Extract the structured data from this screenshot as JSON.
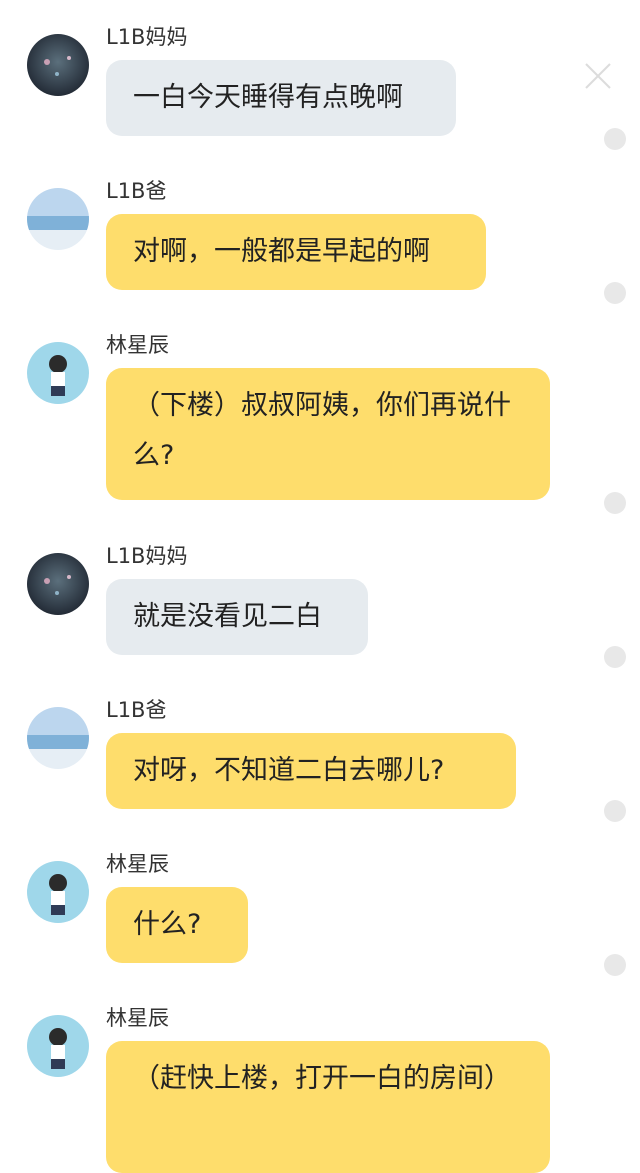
{
  "messages": [
    {
      "sender": "L1B妈妈",
      "text": "一白今天睡得有点晚啊",
      "style": "gray",
      "avatar": "night-sky"
    },
    {
      "sender": "L1B爸",
      "text": "对啊，一般都是早起的啊",
      "style": "yellow",
      "avatar": "sea"
    },
    {
      "sender": "林星辰",
      "text": "（下楼）叔叔阿姨，你们再说什么?",
      "style": "yellow",
      "avatar": "anime-girl"
    },
    {
      "sender": "L1B妈妈",
      "text": "就是没看见二白",
      "style": "gray",
      "avatar": "night-sky"
    },
    {
      "sender": "L1B爸",
      "text": "对呀，不知道二白去哪儿?",
      "style": "yellow",
      "avatar": "sea"
    },
    {
      "sender": "林星辰",
      "text": "什么?",
      "style": "yellow",
      "avatar": "anime-girl"
    },
    {
      "sender": "林星辰",
      "text": "（赶快上楼，打开一白的房间）",
      "style": "yellow",
      "avatar": "anime-girl"
    }
  ],
  "close_icon": "close-icon",
  "colors": {
    "gray_bubble": "#e6ebef",
    "yellow_bubble": "#fedd6c"
  }
}
